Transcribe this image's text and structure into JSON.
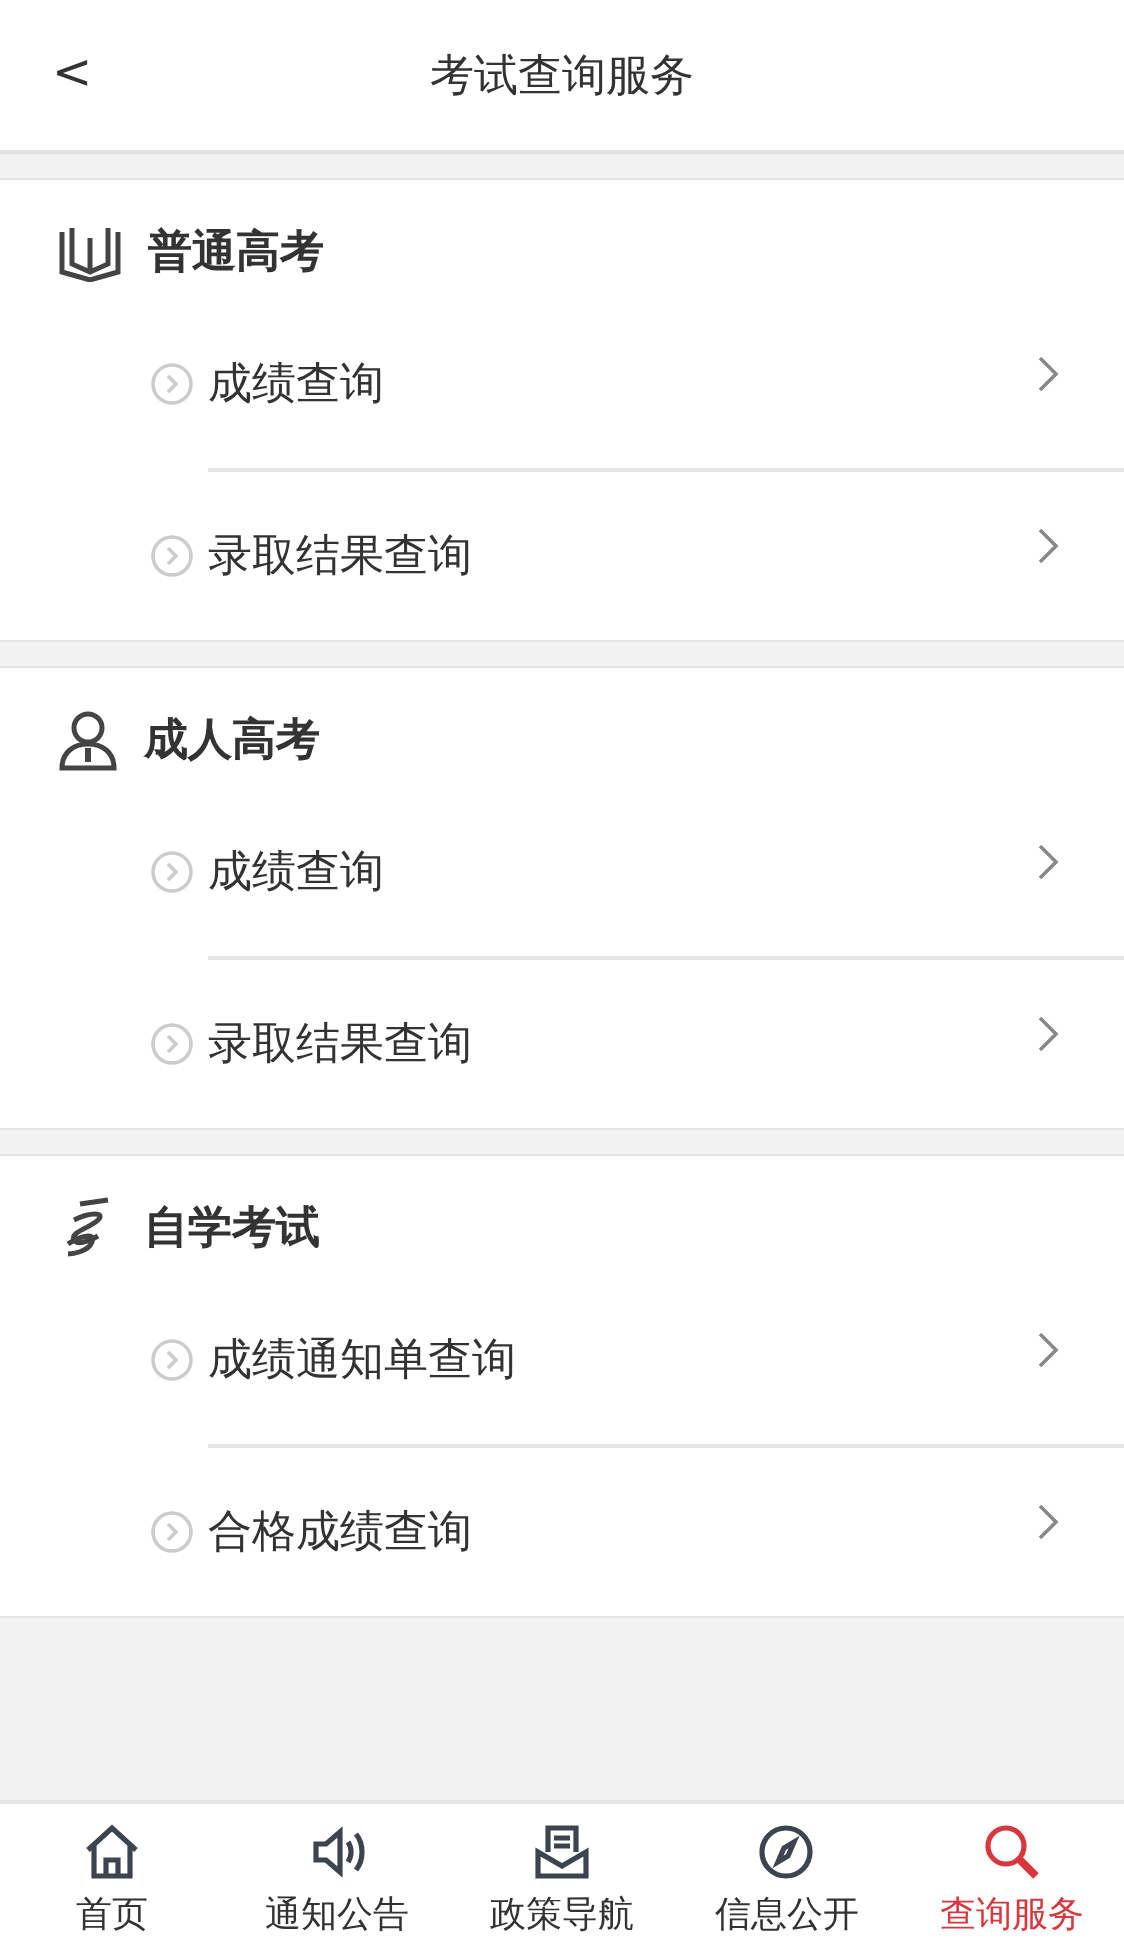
{
  "header": {
    "back": "<",
    "title": "考试查询服务"
  },
  "sections": [
    {
      "kind": "book",
      "title": "普通高考",
      "items": [
        "成绩查询",
        "录取结果查询"
      ]
    },
    {
      "kind": "person",
      "title": "成人高考",
      "items": [
        "成绩查询",
        "录取结果查询"
      ]
    },
    {
      "kind": "scroll",
      "title": "自学考试",
      "items": [
        "成绩通知单查询",
        "合格成绩查询"
      ]
    }
  ],
  "tabs": [
    {
      "kind": "home",
      "label": "首页",
      "selected": false
    },
    {
      "kind": "speaker",
      "label": "通知公告",
      "selected": false
    },
    {
      "kind": "inbox",
      "label": "政策导航",
      "selected": false
    },
    {
      "kind": "compass",
      "label": "信息公开",
      "selected": false
    },
    {
      "kind": "search",
      "label": "查询服务",
      "selected": true
    }
  ]
}
